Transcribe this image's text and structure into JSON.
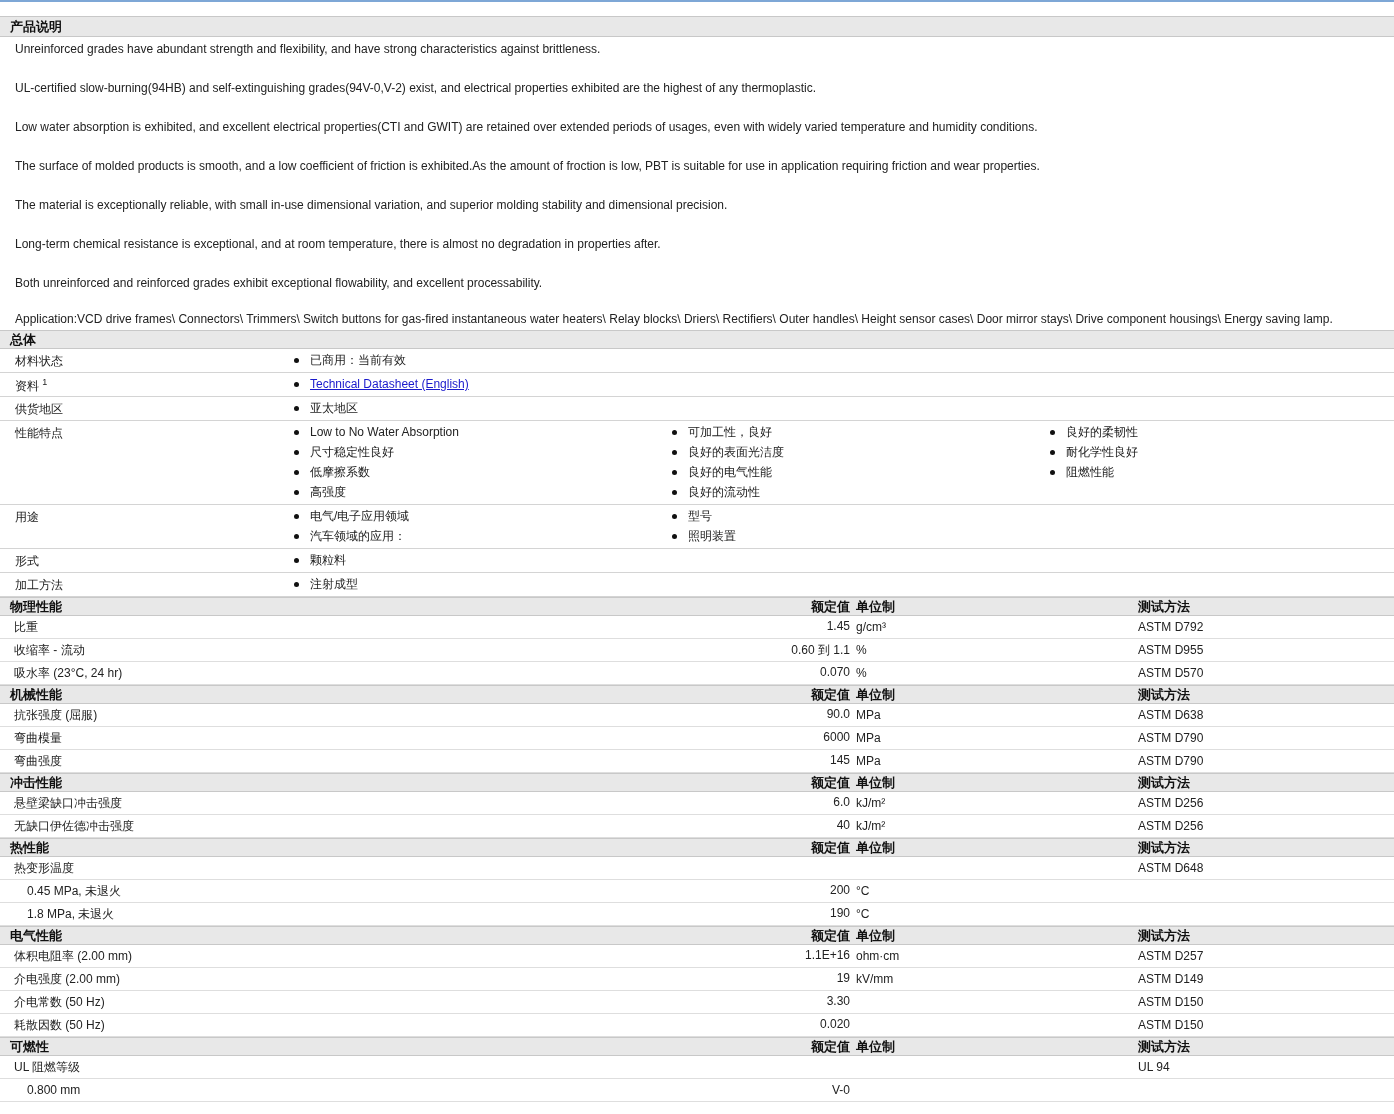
{
  "description": {
    "title": "产品说明",
    "paragraphs": [
      "Unreinforced grades have abundant strength and flexibility, and have strong characteristics against brittleness.",
      "UL-certified slow-burning(94HB) and self-extinguishing grades(94V-0,V-2) exist, and electrical properties exhibited are the highest of any thermoplastic.",
      "Low water absorption is exhibited, and excellent electrical properties(CTI and GWIT) are retained over extended periods of usages, even with widely varied temperature and humidity conditions.",
      "The surface of molded products is smooth, and a low coefficient of friction is exhibited.As the amount of froction is low, PBT is suitable for use in application requiring friction and wear properties.",
      "The material is exceptionally reliable, with small in-use dimensional variation, and superior molding stability and dimensional precision.",
      "Long-term chemical resistance is exceptional, and at room temperature, there is almost no degradation in properties after.",
      "Both unreinforced and reinforced grades exhibit exceptional flowability, and excellent processability.",
      "Application:VCD drive frames\\ Connectors\\ Trimmers\\ Switch buttons for gas-fired instantaneous water heaters\\ Relay blocks\\ Driers\\ Rectifiers\\ Outer handles\\ Height sensor cases\\ Door mirror stays\\ Drive component housings\\ Energy saving lamp."
    ]
  },
  "overview": {
    "title": "总体",
    "rows": [
      {
        "label": "材料状态",
        "columns": [
          [
            {
              "kind": "text",
              "text": "已商用：当前有效"
            }
          ]
        ]
      },
      {
        "label": "资料 $^{1}$",
        "columns": [
          [
            {
              "kind": "link",
              "text": "Technical Datasheet (English)"
            }
          ]
        ]
      },
      {
        "label": "供货地区",
        "columns": [
          [
            {
              "kind": "text",
              "text": "亚太地区"
            }
          ]
        ]
      },
      {
        "label": "性能特点",
        "columns": [
          [
            {
              "kind": "text",
              "text": "Low to No Water Absorption"
            },
            {
              "kind": "text",
              "text": "尺寸稳定性良好"
            },
            {
              "kind": "text",
              "text": "低摩擦系数"
            },
            {
              "kind": "text",
              "text": "高强度"
            }
          ],
          [
            {
              "kind": "text",
              "text": "可加工性，良好"
            },
            {
              "kind": "text",
              "text": "良好的表面光洁度"
            },
            {
              "kind": "text",
              "text": "良好的电气性能"
            },
            {
              "kind": "text",
              "text": "良好的流动性"
            }
          ],
          [
            {
              "kind": "text",
              "text": "良好的柔韧性"
            },
            {
              "kind": "text",
              "text": "耐化学性良好"
            },
            {
              "kind": "text",
              "text": "阻燃性能"
            }
          ]
        ]
      },
      {
        "label": "用途",
        "columns": [
          [
            {
              "kind": "text",
              "text": "电气/电子应用领域"
            },
            {
              "kind": "text",
              "text": "汽车领域的应用："
            }
          ],
          [
            {
              "kind": "text",
              "text": "型号"
            },
            {
              "kind": "text",
              "text": "照明装置"
            }
          ]
        ]
      },
      {
        "label": "形式",
        "columns": [
          [
            {
              "kind": "text",
              "text": "颗粒料"
            }
          ]
        ]
      },
      {
        "label": "加工方法",
        "columns": [
          [
            {
              "kind": "text",
              "text": "注射成型"
            }
          ]
        ]
      }
    ]
  },
  "sections": [
    {
      "title": "物理性能",
      "value_heading": "额定值",
      "unit_heading": "单位制",
      "method_heading": "测试方法",
      "rows": [
        {
          "name": "比重",
          "value": "1.45",
          "unit": "g/cm³",
          "method": "ASTM D792"
        },
        {
          "name": "收缩率  - 流动",
          "value": "0.60 到  1.1",
          "unit": "%",
          "method": "ASTM D955"
        },
        {
          "name": "吸水率  (23°C, 24 hr)",
          "value": "0.070",
          "unit": "%",
          "method": "ASTM D570"
        }
      ]
    },
    {
      "title": "机械性能",
      "value_heading": "额定值",
      "unit_heading": "单位制",
      "method_heading": "测试方法",
      "rows": [
        {
          "name": "抗张强度  (屈服)",
          "value": "90.0",
          "unit": "MPa",
          "method": "ASTM D638"
        },
        {
          "name": "弯曲模量",
          "value": "6000",
          "unit": "MPa",
          "method": "ASTM D790"
        },
        {
          "name": "弯曲强度",
          "value": "145",
          "unit": "MPa",
          "method": "ASTM D790"
        }
      ]
    },
    {
      "title": "冲击性能",
      "value_heading": "额定值",
      "unit_heading": "单位制",
      "method_heading": "测试方法",
      "rows": [
        {
          "name": "悬壁梁缺口冲击强度",
          "value": "6.0",
          "unit": "kJ/m²",
          "method": "ASTM D256"
        },
        {
          "name": "无缺口伊佐德冲击强度",
          "value": "40",
          "unit": "kJ/m²",
          "method": "ASTM D256"
        }
      ]
    },
    {
      "title": "热性能",
      "value_heading": "额定值",
      "unit_heading": "单位制",
      "method_heading": "测试方法",
      "rows": [
        {
          "name": "热变形温度",
          "method": "ASTM D648",
          "children": [
            {
              "name": "0.45 MPa, 未退火",
              "value": "200",
              "unit": "°C"
            },
            {
              "name": "1.8 MPa, 未退火",
              "value": "190",
              "unit": "°C"
            }
          ]
        }
      ]
    },
    {
      "title": "电气性能",
      "value_heading": "额定值",
      "unit_heading": "单位制",
      "method_heading": "测试方法",
      "rows": [
        {
          "name": "体积电阻率  (2.00 mm)",
          "value": "1.1E+16",
          "unit": "ohm·cm",
          "method": "ASTM D257"
        },
        {
          "name": "介电强度  (2.00 mm)",
          "value": "19",
          "unit": "kV/mm",
          "method": "ASTM D149"
        },
        {
          "name": "介电常数  (50 Hz)",
          "value": "3.30",
          "method": "ASTM D150"
        },
        {
          "name": "耗散因数  (50 Hz)",
          "value": "0.020",
          "method": "ASTM D150"
        }
      ]
    },
    {
      "title": "可燃性",
      "value_heading": "额定值",
      "unit_heading": "单位制",
      "method_heading": "测试方法",
      "rows": [
        {
          "name": "UL 阻燃等级",
          "method": "UL 94",
          "children": [
            {
              "name": "0.800 mm",
              "value": "V-0"
            }
          ]
        }
      ]
    }
  ]
}
